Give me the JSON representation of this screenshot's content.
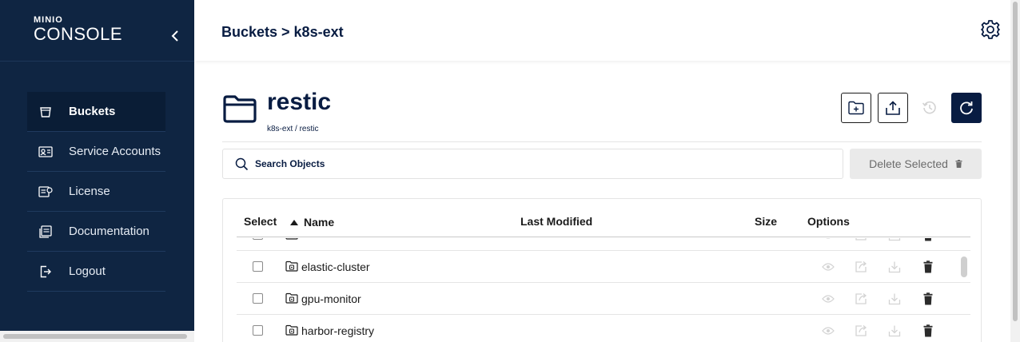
{
  "brand": {
    "small": "MINIO",
    "large": "CONSOLE"
  },
  "nav": [
    {
      "label": "Buckets",
      "icon": "bucket-icon",
      "active": true
    },
    {
      "label": "Service Accounts",
      "icon": "service-accounts-icon"
    },
    {
      "label": "License",
      "icon": "license-icon"
    },
    {
      "label": "Documentation",
      "icon": "documentation-icon"
    },
    {
      "label": "Logout",
      "icon": "logout-icon"
    }
  ],
  "header": {
    "breadcrumb": "Buckets > k8s-ext"
  },
  "bucket": {
    "name": "restic",
    "path": "k8s-ext / restic"
  },
  "toolbar": {
    "create_folder": "folder-plus-icon",
    "upload": "upload-icon",
    "rewind": "history-icon",
    "refresh": "refresh-icon"
  },
  "search": {
    "placeholder": "Search Objects",
    "value": ""
  },
  "actions": {
    "delete_selected": "Delete Selected"
  },
  "table": {
    "columns": [
      "Select",
      "Name",
      "Last Modified",
      "Size",
      "Options"
    ],
    "sort": {
      "column": "Name",
      "direction": "asc"
    },
    "rows": [
      {
        "name": "",
        "type": "folder"
      },
      {
        "name": "elastic-cluster",
        "type": "folder"
      },
      {
        "name": "gpu-monitor",
        "type": "folder"
      },
      {
        "name": "harbor-registry",
        "type": "folder"
      }
    ],
    "row_options": [
      "preview-icon",
      "share-icon",
      "download-icon",
      "delete-icon"
    ]
  },
  "colors": {
    "sidebar": "#0f2542",
    "primary": "#081c42",
    "disabled": "#d3d3d3"
  }
}
